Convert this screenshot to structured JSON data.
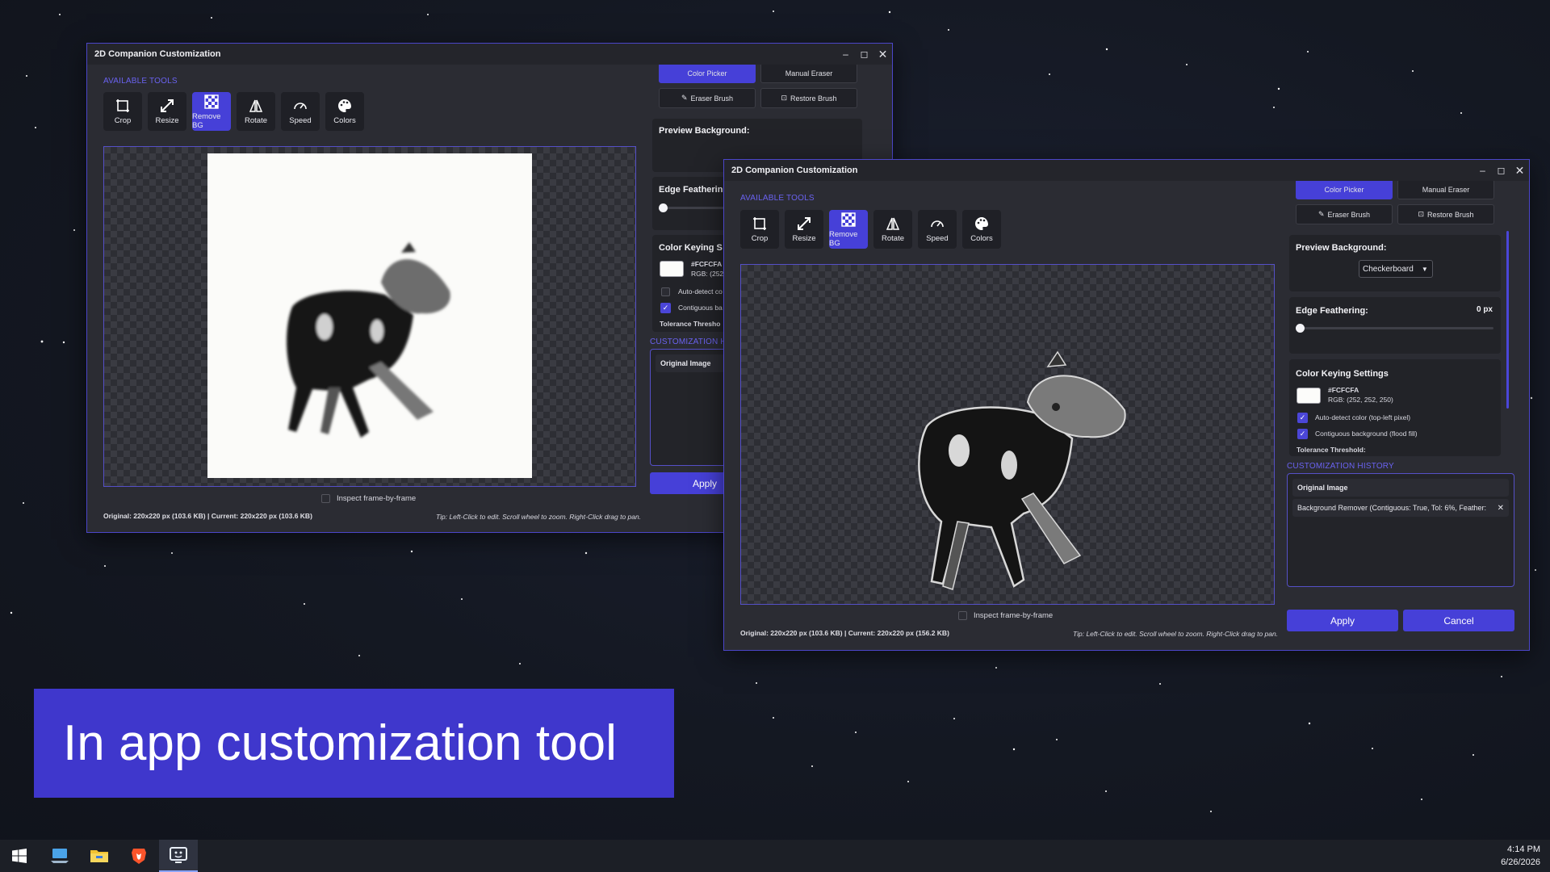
{
  "window_title": "2D Companion Customization",
  "window_controls": {
    "minimize": "–",
    "maximize": "◻",
    "close": "✕"
  },
  "available_tools_label": "AVAILABLE TOOLS",
  "tools": [
    {
      "label": "Crop",
      "icon": "crop-icon",
      "active": false
    },
    {
      "label": "Resize",
      "icon": "resize-icon",
      "active": false
    },
    {
      "label": "Remove BG",
      "icon": "checkerboard-icon",
      "active": true
    },
    {
      "label": "Rotate",
      "icon": "rotate-icon",
      "active": false
    },
    {
      "label": "Speed",
      "icon": "speedometer-icon",
      "active": false
    },
    {
      "label": "Colors",
      "icon": "palette-icon",
      "active": false
    }
  ],
  "brush_buttons": {
    "color_picker": "Color Picker",
    "manual_eraser": "Manual Eraser",
    "eraser_brush": "Eraser Brush",
    "restore_brush": "Restore Brush"
  },
  "preview_background": {
    "title": "Preview Background:",
    "value": "Checkerboard"
  },
  "edge_feathering": {
    "title": "Edge Feathering:",
    "title_cut": "Edge Featherin",
    "value": "0 px",
    "level": 0
  },
  "color_keying": {
    "title": "Color Keying Settings",
    "title_cut": "Color Keying S",
    "swatch_color": "#FCFCFA",
    "hex": "#FCFCFA",
    "hex_cut": "#FCFCFA",
    "rgb": "RGB: (252, 252, 250)",
    "rgb_cut": "RGB: (252,",
    "auto_detect": "Auto-detect color (top-left pixel)",
    "auto_detect_cut": "Auto-detect co",
    "contiguous": "Contiguous background (flood fill)",
    "contiguous_cut": "Contiguous ba",
    "tolerance": "Tolerance Threshold:",
    "tolerance_cut": "Tolerance Thresho"
  },
  "history": {
    "label": "CUSTOMIZATION HISTORY",
    "label_cut": "CUSTOMIZATION H",
    "original": "Original Image",
    "entry": "Background Remover (Contiguous: True, Tol: 6%, Feather:",
    "remove_icon": "✕"
  },
  "inspect_label": "Inspect frame-by-frame",
  "window1": {
    "status": "Original: 220x220 px (103.6 KB) | Current: 220x220 px (103.6 KB)"
  },
  "window2": {
    "status": "Original: 220x220 px (103.6 KB) | Current: 220x220 px (156.2 KB)"
  },
  "tip": "Tip: Left-Click to edit. Scroll wheel to zoom. Right-Click drag to pan.",
  "apply_label": "Apply",
  "cancel_label": "Cancel",
  "caption": "In app customization tool",
  "taskbar": {
    "icons": [
      "windows-start-icon",
      "computer-icon",
      "file-explorer-icon",
      "brave-browser-icon",
      "companion-app-icon"
    ],
    "time": "4:14 PM",
    "date": "6/26/2026"
  },
  "colors": {
    "accent": "#4640D8",
    "window_bg": "#2B2C33",
    "caption_bg": "#3F37CC"
  }
}
